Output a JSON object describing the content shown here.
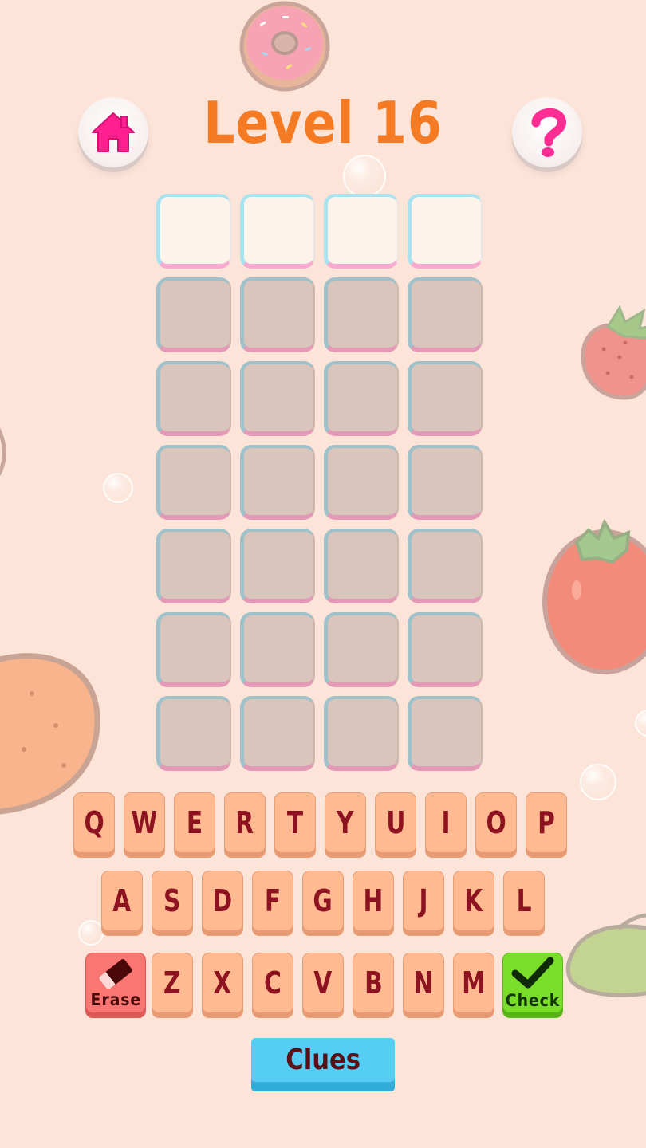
{
  "header": {
    "title": "Level 16",
    "home_icon": "home-icon",
    "help_icon": "question-mark-icon"
  },
  "grid": {
    "rows": 7,
    "columns": 4,
    "active_row": 1
  },
  "keyboard": {
    "row1": [
      "Q",
      "W",
      "E",
      "R",
      "T",
      "Y",
      "U",
      "I",
      "O",
      "P"
    ],
    "row2": [
      "A",
      "S",
      "D",
      "F",
      "G",
      "H",
      "J",
      "K",
      "L"
    ],
    "row3": [
      "Z",
      "X",
      "C",
      "V",
      "B",
      "N",
      "M"
    ],
    "erase_label": "Erase",
    "check_label": "Check",
    "erase_icon": "eraser-icon",
    "check_icon": "checkmark-icon"
  },
  "clues_label": "Clues",
  "colors": {
    "background": "#fce4d8",
    "title": "#f47b23",
    "key": "#ffba92",
    "key_text": "#8e1320",
    "erase": "#f97672",
    "check": "#79dd2a",
    "clues": "#55cdf4",
    "home_icon": "#ff1f8f"
  }
}
